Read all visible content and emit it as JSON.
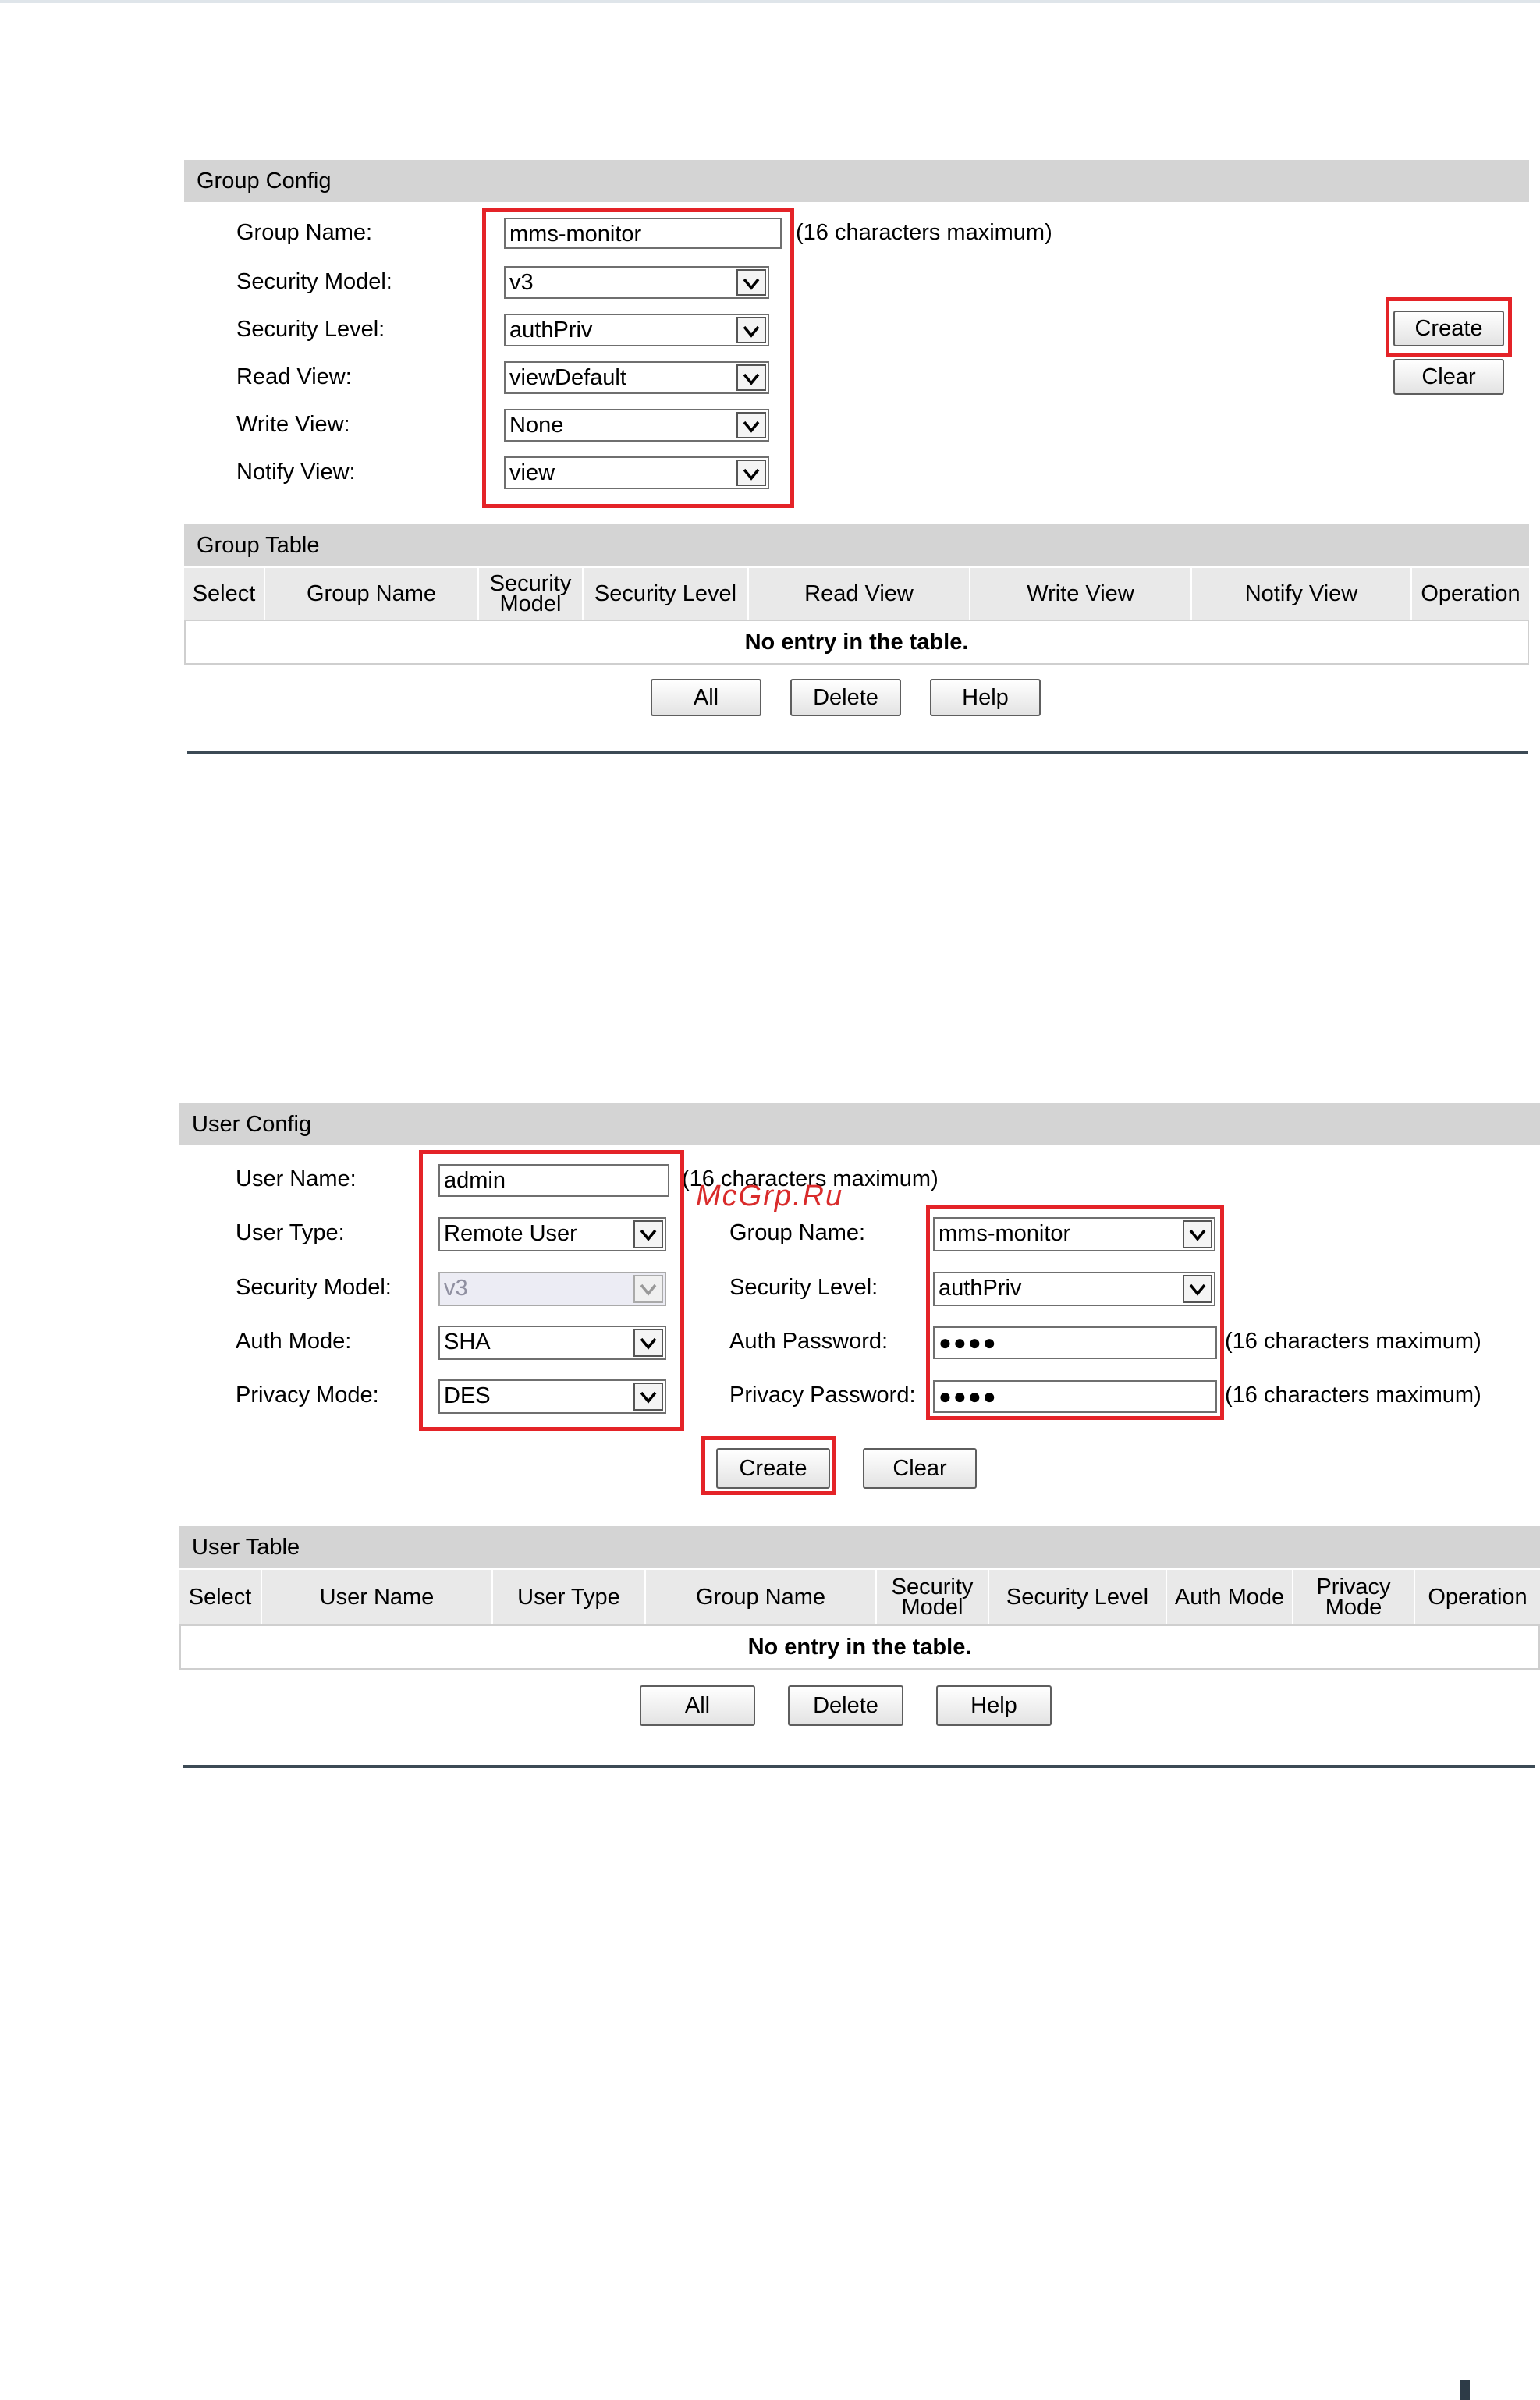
{
  "group_config": {
    "title": "Group Config",
    "group_name": {
      "label": "Group Name:",
      "value": "mms-monitor",
      "hint": "(16 characters maximum)"
    },
    "security_model": {
      "label": "Security Model:",
      "value": "v3"
    },
    "security_level": {
      "label": "Security Level:",
      "value": "authPriv"
    },
    "read_view": {
      "label": "Read View:",
      "value": "viewDefault"
    },
    "write_view": {
      "label": "Write View:",
      "value": "None"
    },
    "notify_view": {
      "label": "Notify View:",
      "value": "view"
    },
    "create_label": "Create",
    "clear_label": "Clear"
  },
  "group_table": {
    "title": "Group Table",
    "columns": [
      "Select",
      "Group Name",
      "Security Model",
      "Security Level",
      "Read View",
      "Write View",
      "Notify View",
      "Operation"
    ],
    "empty_text": "No entry in the table.",
    "buttons": {
      "all": "All",
      "delete": "Delete",
      "help": "Help"
    }
  },
  "user_config": {
    "title": "User Config",
    "user_name": {
      "label": "User Name:",
      "value": "admin",
      "hint": "(16 characters maximum)"
    },
    "user_type": {
      "label": "User Type:",
      "value": "Remote User"
    },
    "security_model": {
      "label": "Security Model:",
      "value": "v3"
    },
    "auth_mode": {
      "label": "Auth Mode:",
      "value": "SHA"
    },
    "privacy_mode": {
      "label": "Privacy Mode:",
      "value": "DES"
    },
    "group_name": {
      "label": "Group Name:",
      "value": "mms-monitor"
    },
    "security_level": {
      "label": "Security Level:",
      "value": "authPriv"
    },
    "auth_password": {
      "label": "Auth Password:",
      "value": "●●●●",
      "hint": "(16 characters maximum)"
    },
    "privacy_password": {
      "label": "Privacy Password:",
      "value": "●●●●",
      "hint": "(16 characters maximum)"
    },
    "create_label": "Create",
    "clear_label": "Clear"
  },
  "user_table": {
    "title": "User Table",
    "columns": [
      "Select",
      "User Name",
      "User Type",
      "Group Name",
      "Security Model",
      "Security Level",
      "Auth Mode",
      "Privacy Mode",
      "Operation"
    ],
    "empty_text": "No entry in the table.",
    "buttons": {
      "all": "All",
      "delete": "Delete",
      "help": "Help"
    }
  },
  "watermark": "McGrp.Ru",
  "highlight_color": "#e42328",
  "icons": {
    "dropdown": "chevron-down-icon"
  }
}
